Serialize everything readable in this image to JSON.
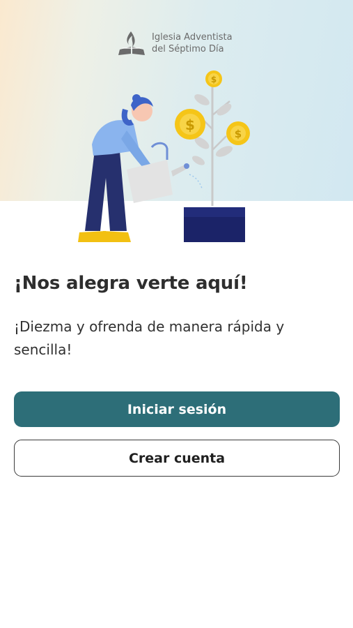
{
  "header": {
    "logo_line1": "Iglesia Adventista",
    "logo_line2": "del Séptimo Día"
  },
  "illustration": {
    "name": "person-watering-money-plant",
    "coin_symbol": "$",
    "colors": {
      "coin": "#f5c518",
      "pot": "#1b2368",
      "pants": "#26306e",
      "shirt": "#8ab4ee",
      "shoes": "#f2c012",
      "can": "#e3e3e3"
    }
  },
  "main": {
    "headline": "¡Nos alegra verte aquí!",
    "subtext": "¡Diezma y ofrenda de manera rápida y sencilla!"
  },
  "actions": {
    "login_label": "Iniciar sesión",
    "register_label": "Crear cuenta"
  },
  "theme": {
    "primary": "#2d6e78",
    "text": "#2e2e2e"
  }
}
